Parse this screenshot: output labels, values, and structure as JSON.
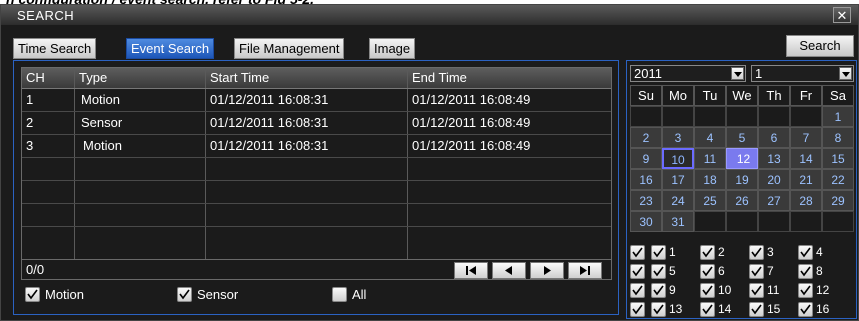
{
  "window": {
    "title": "SEARCH",
    "close_icon": "close-icon"
  },
  "tabs": [
    {
      "label": "Time Search",
      "active": false
    },
    {
      "label": "Event Search",
      "active": true
    },
    {
      "label": "File Management",
      "active": false
    },
    {
      "label": "Image",
      "active": false
    }
  ],
  "search_button": "Search",
  "table": {
    "headers": [
      "CH",
      "Type",
      "Start Time",
      "End Time"
    ],
    "rows": [
      [
        "1",
        "Motion",
        "01/12/2011 16:08:31",
        "01/12/2011 16:08:49"
      ],
      [
        "2",
        "Sensor",
        "01/12/2011 16:08:31",
        "01/12/2011 16:08:49"
      ],
      [
        "3",
        "Motion",
        "01/12/2011 16:08:31",
        "01/12/2011 16:08:49"
      ]
    ],
    "count": "0/0"
  },
  "filters": [
    {
      "label": "Motion",
      "checked": true
    },
    {
      "label": "Sensor",
      "checked": true
    },
    {
      "label": "All",
      "checked": false
    }
  ],
  "calendar": {
    "year": "2011",
    "month": "1",
    "weekdays": [
      "Su",
      "Mo",
      "Tu",
      "We",
      "Th",
      "Fr",
      "Sa"
    ],
    "days": [
      "1",
      "2",
      "3",
      "4",
      "5",
      "6",
      "7",
      "8",
      "9",
      "10",
      "11",
      "12",
      "13",
      "14",
      "15",
      "16",
      "17",
      "18",
      "19",
      "20",
      "21",
      "22",
      "23",
      "24",
      "25",
      "26",
      "27",
      "28",
      "29",
      "30",
      "31"
    ],
    "highlighted_day": "10",
    "selected_day": "12"
  },
  "hours": [
    "1",
    "2",
    "3",
    "4",
    "5",
    "6",
    "7",
    "8",
    "9",
    "10",
    "11",
    "12",
    "13",
    "14",
    "15",
    "16"
  ],
  "colors": {
    "accent": "#2b62c2",
    "active_tab": "#2f6fd0",
    "selected_day": "#7a7aee"
  }
}
